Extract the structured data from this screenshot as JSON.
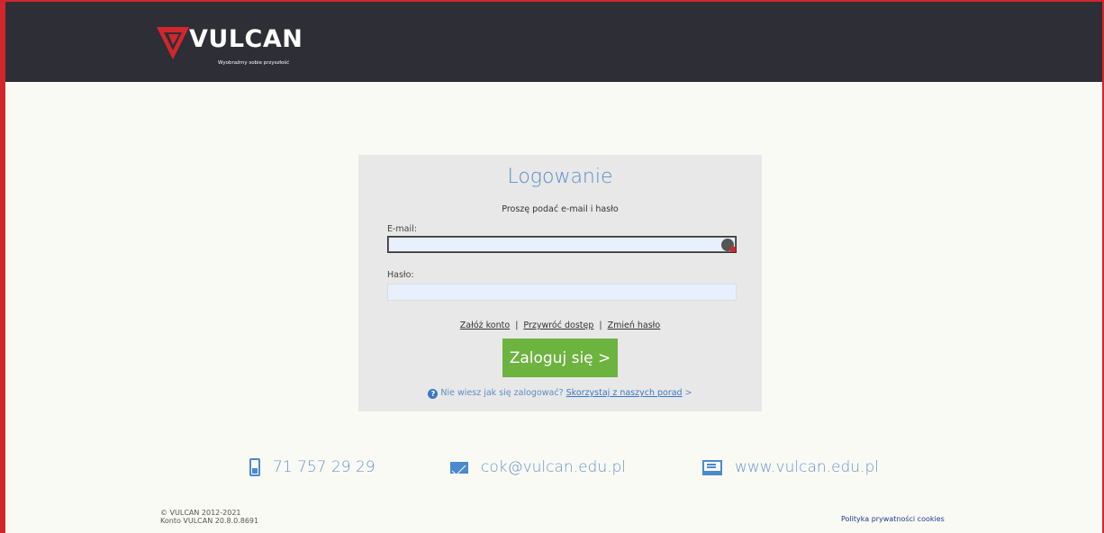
{
  "header": {
    "logo_text": "VULCAN",
    "tagline": "Wyobraźmy sobie przyszłość",
    "bg_color": "#2e2e36",
    "accent_color": "#d1272c"
  },
  "login": {
    "title": "Logowanie",
    "subtitle": "Proszę podać e-mail i hasło",
    "email_label": "E-mail:",
    "email_value": "",
    "password_label": "Hasło:",
    "password_value": "",
    "links": {
      "create_account": "Załóż konto",
      "restore_access": "Przywróć dostęp",
      "change_password": "Zmień hasło",
      "separator": "|"
    },
    "submit_label": "Zaloguj się >",
    "help_text": "Nie wiesz jak się zalogować?",
    "help_link": "Skorzystaj z naszych porad",
    "help_arrow": ">"
  },
  "contact": {
    "phone": "71 757 29 29",
    "email": "cok@vulcan.edu.pl",
    "website": "www.vulcan.edu.pl"
  },
  "footer": {
    "copyright": "© VULCAN 2012-2021",
    "version": "Konto VULCAN 20.8.0.8691",
    "privacy_link": "Polityka prywatności cookies"
  },
  "icons": [
    "vulcan-logo-icon",
    "password-manager-icon",
    "help-icon",
    "phone-icon",
    "mail-icon",
    "computer-icon"
  ]
}
